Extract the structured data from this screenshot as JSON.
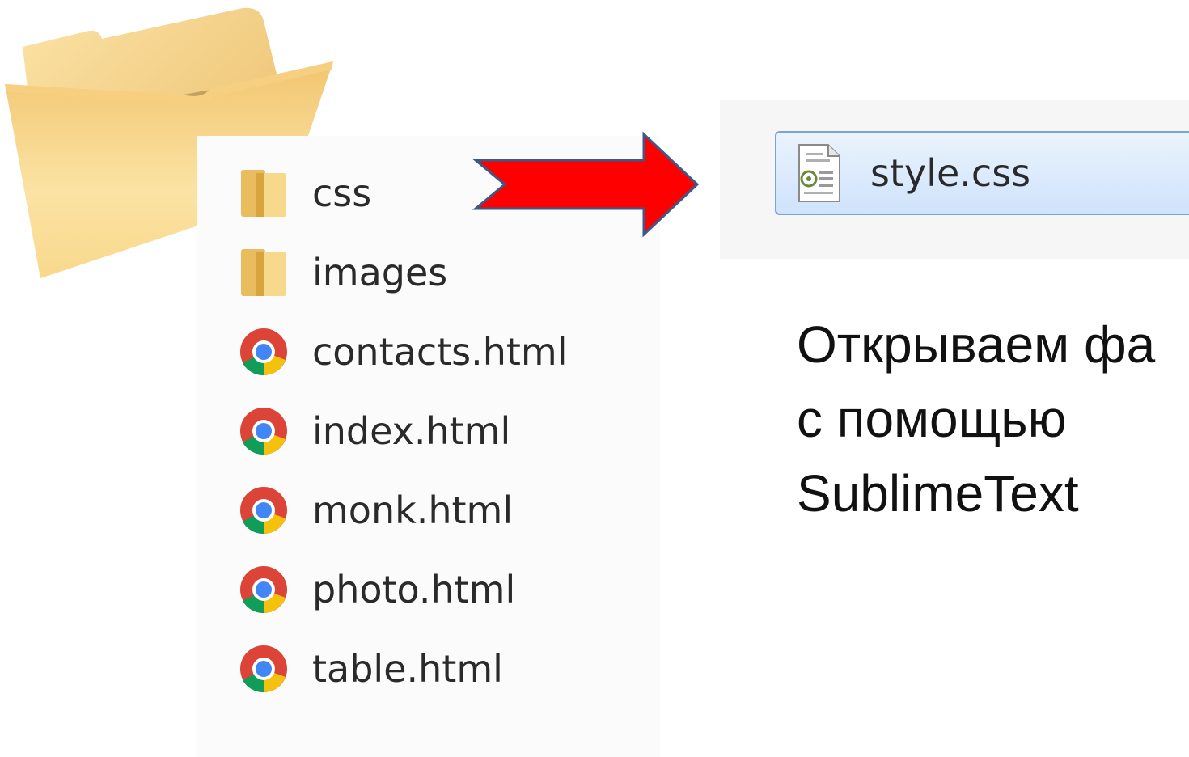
{
  "folder_contents": {
    "items": [
      {
        "label": "css",
        "icon": "folder-icon"
      },
      {
        "label": "images",
        "icon": "folder-icon"
      },
      {
        "label": "contacts.html",
        "icon": "chrome-icon"
      },
      {
        "label": "index.html",
        "icon": "chrome-icon"
      },
      {
        "label": "monk.html",
        "icon": "chrome-icon"
      },
      {
        "label": "photo.html",
        "icon": "chrome-icon"
      },
      {
        "label": "table.html",
        "icon": "chrome-icon"
      }
    ]
  },
  "selected_file": {
    "label": "style.css",
    "icon": "css-file-icon"
  },
  "caption": {
    "line1": "Открываем фа",
    "line2": "с помощью",
    "line3": "SublimeText"
  },
  "colors": {
    "arrow": "#ff0000",
    "arrow_border": "#3a5a8c",
    "selection_border": "#7da2ce",
    "folder_yellow": "#f6d27a"
  }
}
